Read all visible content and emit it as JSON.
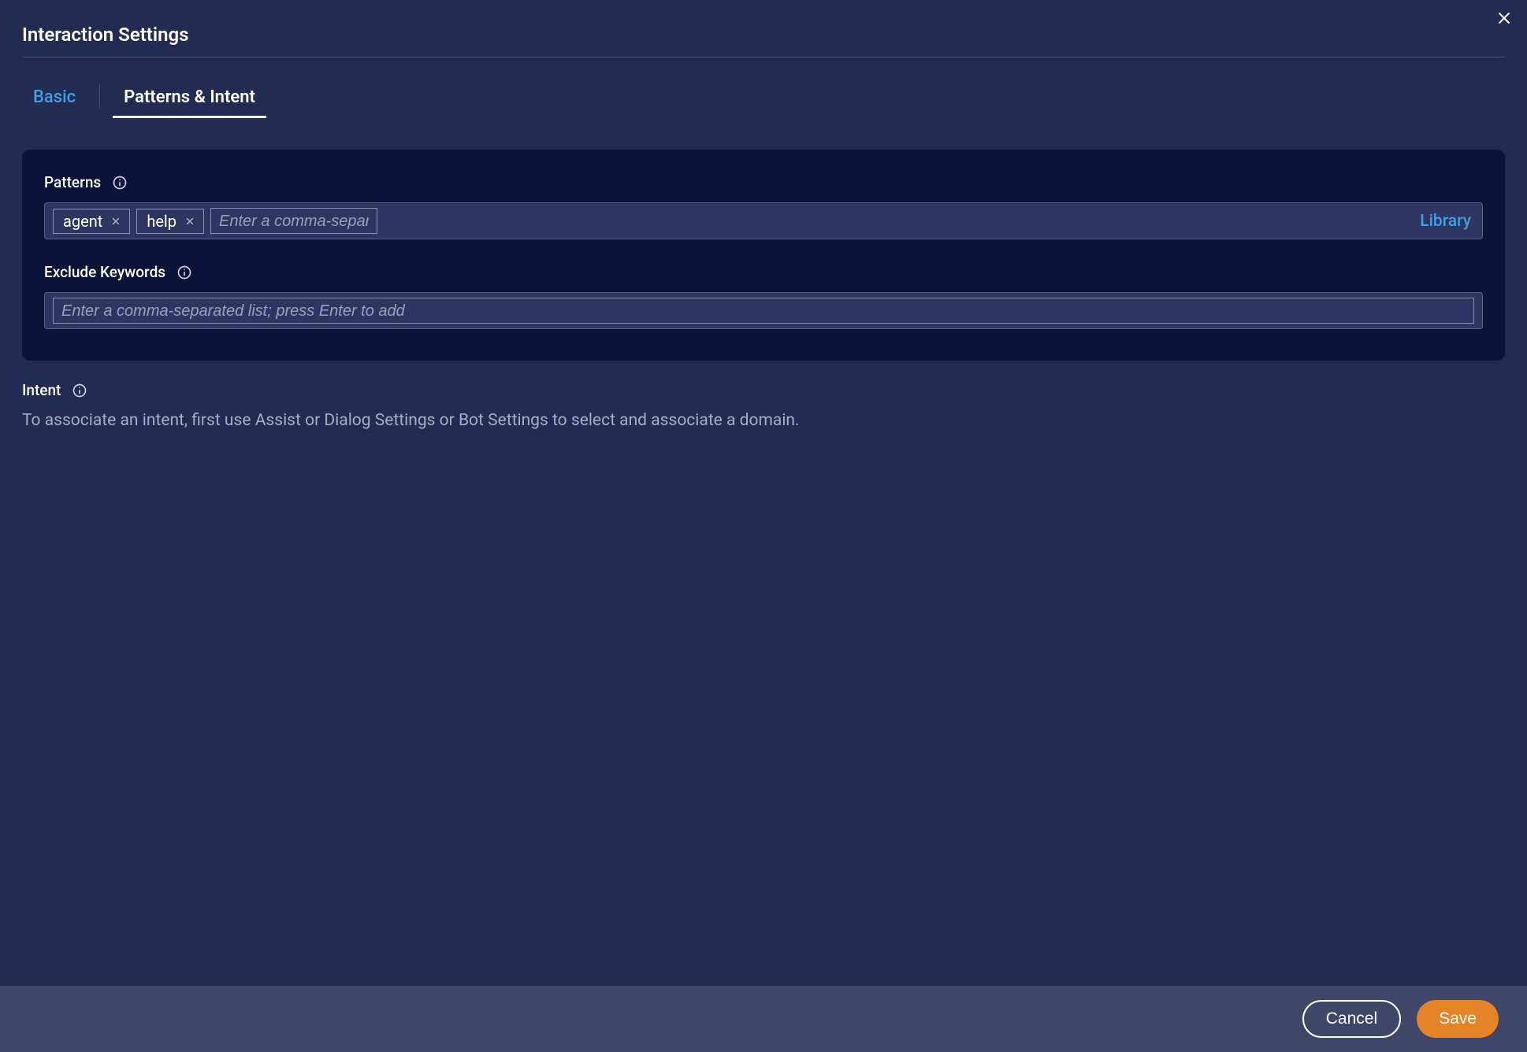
{
  "modal": {
    "title": "Interaction Settings"
  },
  "tabs": {
    "basic": "Basic",
    "patterns_intent": "Patterns & Intent"
  },
  "patterns": {
    "label": "Patterns",
    "chips": [
      "agent",
      "help"
    ],
    "placeholder": "Enter a comma-separated list; press Enter to add",
    "library_link": "Library"
  },
  "exclude": {
    "label": "Exclude Keywords",
    "placeholder": "Enter a comma-separated list; press Enter to add"
  },
  "intent": {
    "label": "Intent",
    "description": "To associate an intent, first use Assist or Dialog Settings or Bot Settings to select and associate a domain."
  },
  "footer": {
    "cancel": "Cancel",
    "save": "Save"
  }
}
